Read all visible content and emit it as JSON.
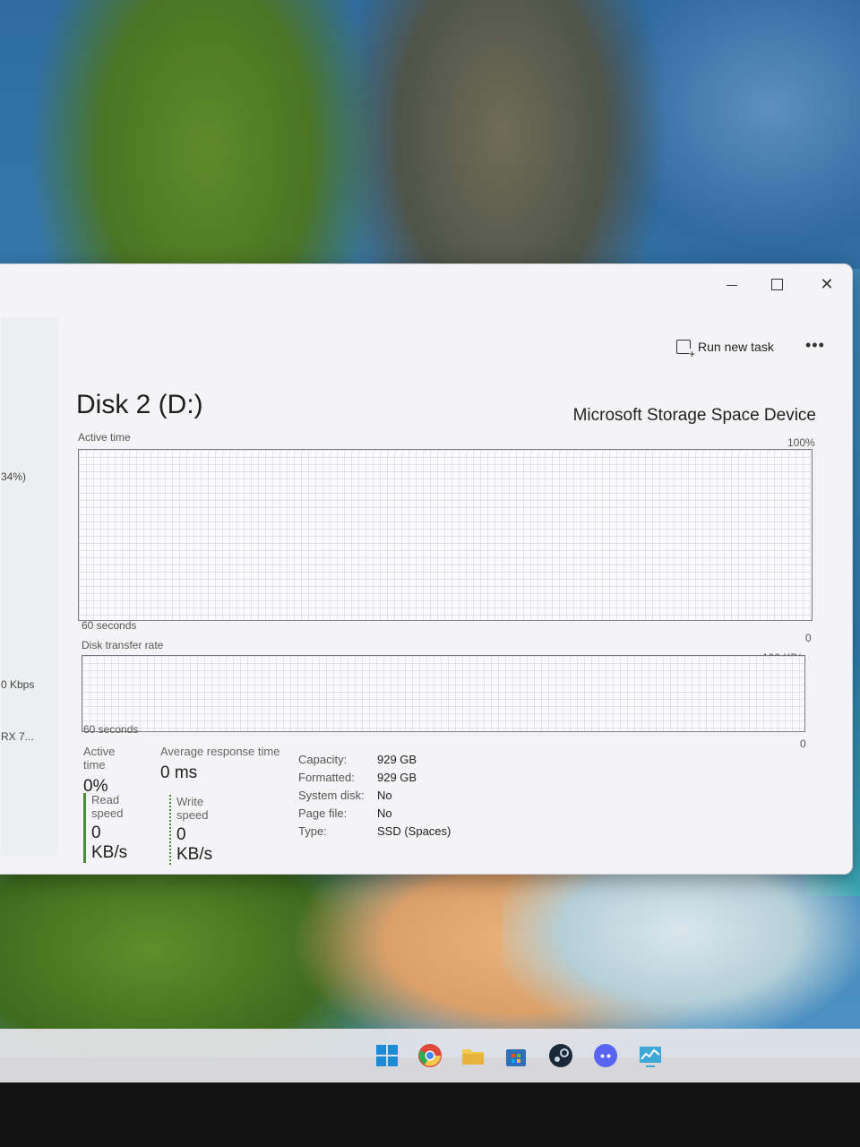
{
  "window": {
    "run_new_task": "Run new task",
    "more": "•••",
    "close_glyph": "✕"
  },
  "sidebar_fragments": {
    "item1": "34%)",
    "item2": "0 Kbps",
    "item3": "RX 7..."
  },
  "disk": {
    "title": "Disk 2 (D:)",
    "model": "Microsoft Storage Space Device",
    "active_time_graph": {
      "label": "Active time",
      "max_label": "100%",
      "time_label": "60 seconds",
      "min_label": "0"
    },
    "transfer_graph": {
      "label": "Disk transfer rate",
      "max_label": "100 KB/s",
      "time_label": "60 seconds",
      "min_label": "0"
    },
    "stats": {
      "active_time_label": "Active time",
      "active_time_value": "0%",
      "avg_response_label": "Average response time",
      "avg_response_value": "0 ms",
      "read_label": "Read speed",
      "read_value": "0 KB/s",
      "write_label": "Write speed",
      "write_value": "0 KB/s"
    },
    "properties": [
      {
        "key": "Capacity:",
        "value": "929 GB"
      },
      {
        "key": "Formatted:",
        "value": "929 GB"
      },
      {
        "key": "System disk:",
        "value": "No"
      },
      {
        "key": "Page file:",
        "value": "No"
      },
      {
        "key": "Type:",
        "value": "SSD (Spaces)"
      }
    ]
  },
  "taskbar": {
    "icons": [
      "windows-start-icon",
      "chrome-icon",
      "file-explorer-icon",
      "microsoft-store-icon",
      "steam-icon",
      "discord-icon",
      "task-manager-icon"
    ],
    "colors": {
      "windows": "#1e8ad6",
      "chrome": "#e0463a",
      "explorer": "#f2c94c",
      "store": "#2d6fb8",
      "steam": "#1b2838",
      "discord": "#5865f2",
      "taskmgr": "#3fa7d6"
    }
  }
}
